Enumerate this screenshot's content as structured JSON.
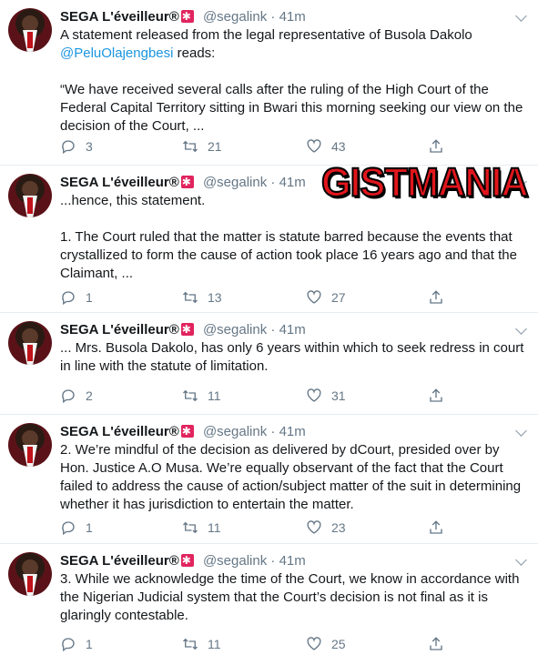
{
  "watermark_text": "GISTMANIA",
  "colors": {
    "link": "#1b95e0",
    "muted": "#657786",
    "watermark": "#e0161c",
    "badge": "#e0245e"
  },
  "tweets": [
    {
      "name": "SEGA L'éveilleur®",
      "handle": "@segalink",
      "dot": "·",
      "time": "41m",
      "text_before": "A statement released from the legal representative of Busola Dakolo",
      "mention": "@PeluOlajengbesi",
      "text_after": " reads:",
      "text2": "“We have received several calls after the ruling of the High Court of the Federal Capital Territory sitting in Bwari this morning seeking our view on the decision of the Court, ...",
      "replies": "3",
      "retweets": "21",
      "likes": "43"
    },
    {
      "name": "SEGA L'éveilleur®",
      "handle": "@segalink",
      "dot": "·",
      "time": "41m",
      "text1": "...hence, this statement.",
      "text2": "1. The Court ruled that the matter is statute barred because the events that crystallized to form the cause of action took place 16 years ago and that the Claimant, ...",
      "replies": "1",
      "retweets": "13",
      "likes": "27"
    },
    {
      "name": "SEGA L'éveilleur®",
      "handle": "@segalink",
      "dot": "·",
      "time": "41m",
      "text1": "... Mrs. Busola Dakolo, has only 6 years within which to seek redress in court in line with the statute of limitation.",
      "replies": "2",
      "retweets": "11",
      "likes": "31"
    },
    {
      "name": "SEGA L'éveilleur®",
      "handle": "@segalink",
      "dot": "·",
      "time": "41m",
      "text1": "2. We’re mindful of the decision as delivered by dCourt, presided over by Hon. Justice A.O Musa. We’re equally observant of the fact that the Court failed to address the cause of action/subject matter of the suit in determining whether it has jurisdiction to entertain the matter.",
      "replies": "1",
      "retweets": "11",
      "likes": "23"
    },
    {
      "name": "SEGA L'éveilleur®",
      "handle": "@segalink",
      "dot": "·",
      "time": "41m",
      "text1": "3. While we acknowledge the time of the Court, we know in accordance with the Nigerian Judicial system that the Court’s decision is not final as it is glaringly contestable.",
      "replies": "1",
      "retweets": "11",
      "likes": "25"
    }
  ]
}
